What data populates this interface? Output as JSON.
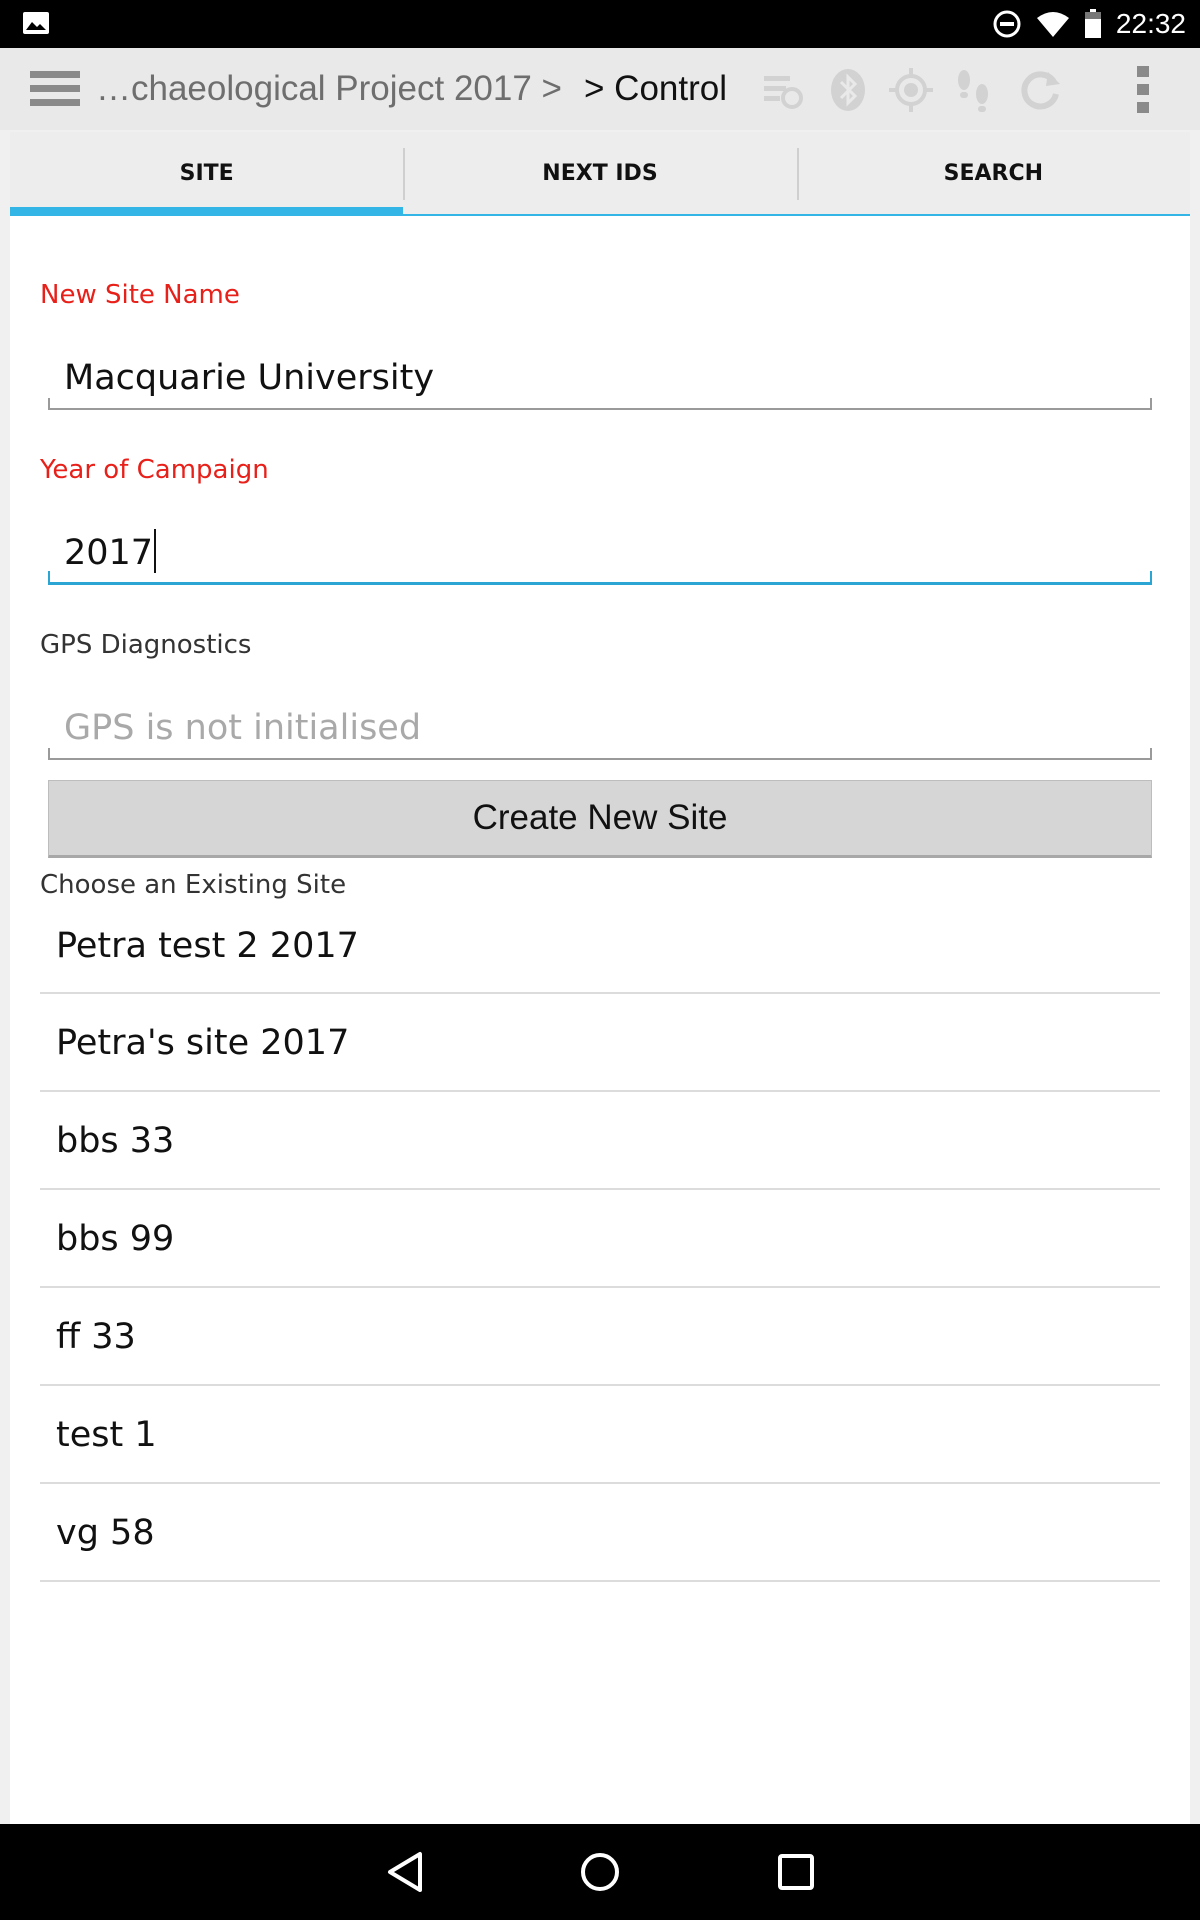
{
  "status_bar": {
    "time": "22:32",
    "icons": [
      "image-icon",
      "do-not-disturb-icon",
      "wifi-icon",
      "battery-icon"
    ]
  },
  "action_bar": {
    "breadcrumb_previous": "…chaeological Project 2017 >",
    "breadcrumb_current": "> Control",
    "icons": [
      "sync-list-icon",
      "bluetooth-icon",
      "gps-icon",
      "tracking-icon",
      "refresh-icon",
      "overflow-menu-icon"
    ]
  },
  "tabs": [
    {
      "label": "SITE",
      "active": true
    },
    {
      "label": "NEXT IDS",
      "active": false
    },
    {
      "label": "SEARCH",
      "active": false
    }
  ],
  "form": {
    "site_name_label": "New Site Name",
    "site_name_value": "Macquarie University",
    "year_label": "Year of Campaign",
    "year_value": "2017",
    "gps_label": "GPS Diagnostics",
    "gps_hint": "GPS is not initialised",
    "create_button": "Create New Site",
    "existing_label": "Choose an Existing Site"
  },
  "existing_sites": [
    "Petra test 2 2017",
    "Petra's site 2017",
    "bbs 33",
    "bbs 99",
    "ff 33",
    "test 1",
    "vg 58"
  ],
  "colors": {
    "accent": "#33b5e5",
    "required_label": "#e8201a",
    "focus_underline": "#2aa5d4"
  },
  "nav_bar": {
    "icons": [
      "back-icon",
      "home-icon",
      "recents-icon"
    ]
  }
}
